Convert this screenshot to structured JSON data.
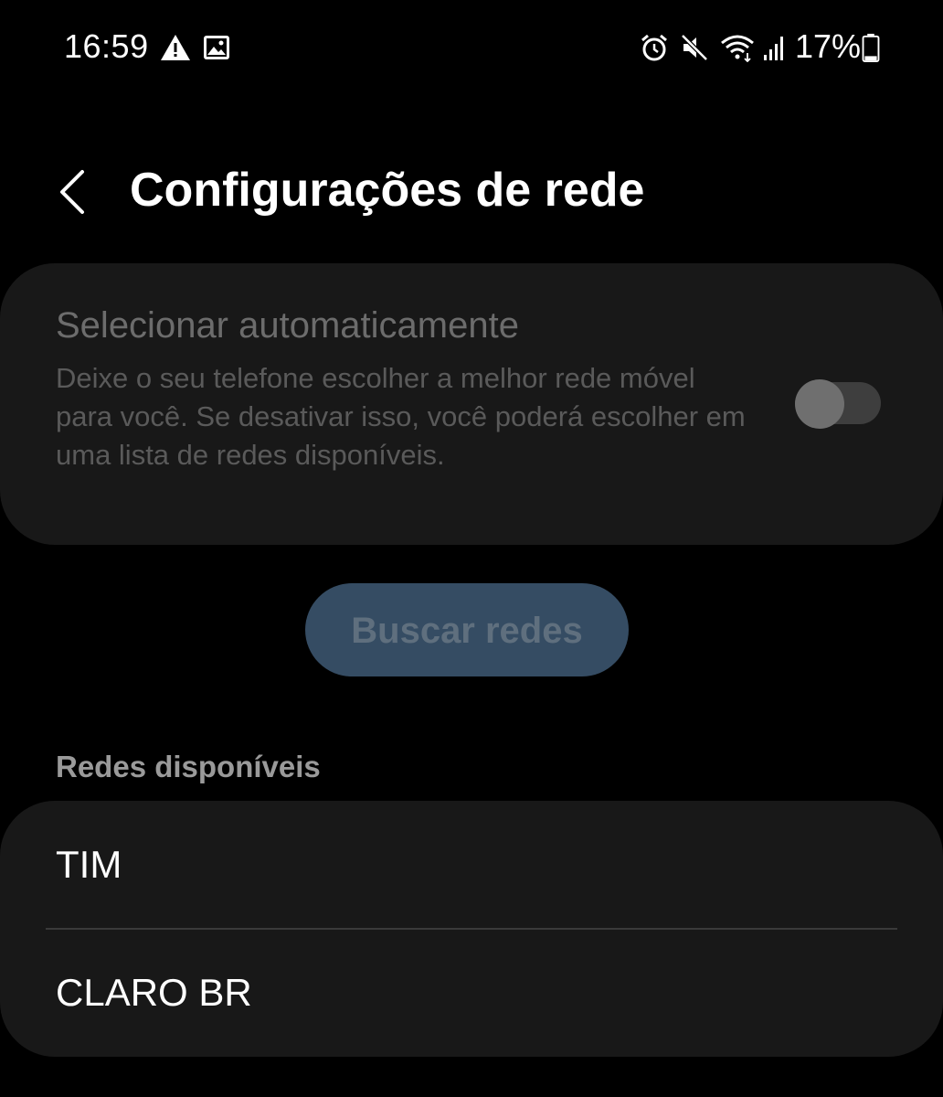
{
  "status_bar": {
    "time": "16:59",
    "battery_percent": "17%",
    "icons": [
      "warning-icon",
      "image-icon",
      "alarm-icon",
      "mute-icon",
      "wifi-icon",
      "signal-icon",
      "battery-icon"
    ],
    "battery_level": 0.17
  },
  "header": {
    "title": "Configurações de rede"
  },
  "auto_select": {
    "title": "Selecionar automaticamente",
    "description": "Deixe o seu telefone escolher a melhor rede móvel para você. Se desativar isso, você poderá escolher em uma lista de redes disponíveis.",
    "enabled": false
  },
  "search_button": {
    "label": "Buscar redes"
  },
  "networks": {
    "header": "Redes disponíveis",
    "items": [
      {
        "label": "TIM"
      },
      {
        "label": "CLARO BR"
      }
    ]
  },
  "colors": {
    "background": "#000000",
    "card": "#181818",
    "button": "#354c63"
  }
}
